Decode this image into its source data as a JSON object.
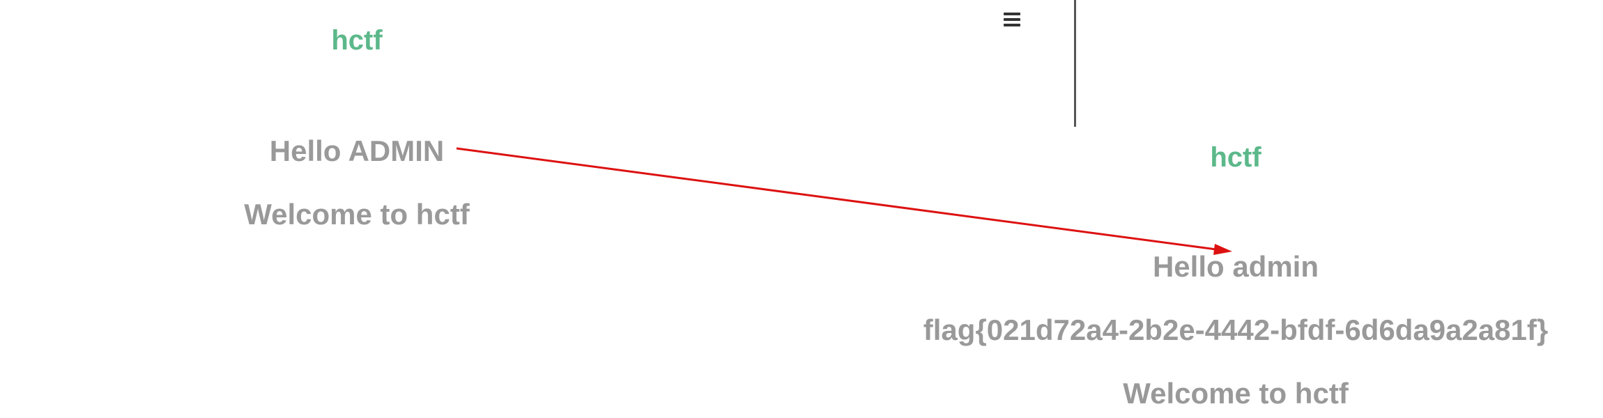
{
  "left_panel": {
    "brand": "hctf",
    "greeting": "Hello ADMIN",
    "welcome": "Welcome to hctf"
  },
  "right_panel": {
    "brand": "hctf",
    "greeting": "Hello admin",
    "flag": "flag{021d72a4-2b2e-4442-bfdf-6d6da9a2a81f}",
    "welcome": "Welcome to hctf"
  },
  "icons": {
    "menu": "hamburger-menu-icon",
    "annotation": "red-arrow"
  },
  "colors": {
    "brand": "#5cb88a",
    "text": "#999999",
    "menu": "#333333",
    "divider": "#555555",
    "arrow": "#dd1111"
  }
}
